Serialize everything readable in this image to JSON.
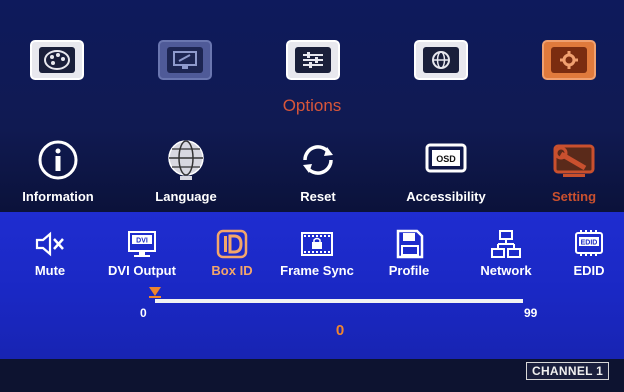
{
  "menu": {
    "title": "Options",
    "top_icons": [
      {
        "name": "palette-icon"
      },
      {
        "name": "display-icon"
      },
      {
        "name": "input-icon"
      },
      {
        "name": "web-icon"
      },
      {
        "name": "gear-icon"
      }
    ],
    "settings_row": [
      {
        "label": "Information",
        "icon": "info-icon"
      },
      {
        "label": "Language",
        "icon": "globe-icon"
      },
      {
        "label": "Reset",
        "icon": "refresh-icon"
      },
      {
        "label": "Accessibility",
        "icon": "osd-icon"
      },
      {
        "label": "Setting",
        "icon": "tools-icon",
        "active": true
      }
    ],
    "sub_row": [
      {
        "label": "Mute",
        "icon": "mute-icon"
      },
      {
        "label": "DVI Output",
        "icon": "dvi-icon"
      },
      {
        "label": "Box ID",
        "icon": "id-icon",
        "active": true
      },
      {
        "label": "Frame Sync",
        "icon": "frame-sync-icon"
      },
      {
        "label": "Profile",
        "icon": "save-icon"
      },
      {
        "label": "Network",
        "icon": "network-icon"
      },
      {
        "label": "EDID",
        "icon": "edid-icon"
      }
    ]
  },
  "slider": {
    "min": "0",
    "max": "99",
    "value": "0",
    "fraction": 0.0
  },
  "status": {
    "channel": "CHANNEL 1"
  },
  "colors": {
    "accent": "#f0852e",
    "title": "#d8563a",
    "panel": "#1f2dd0"
  }
}
